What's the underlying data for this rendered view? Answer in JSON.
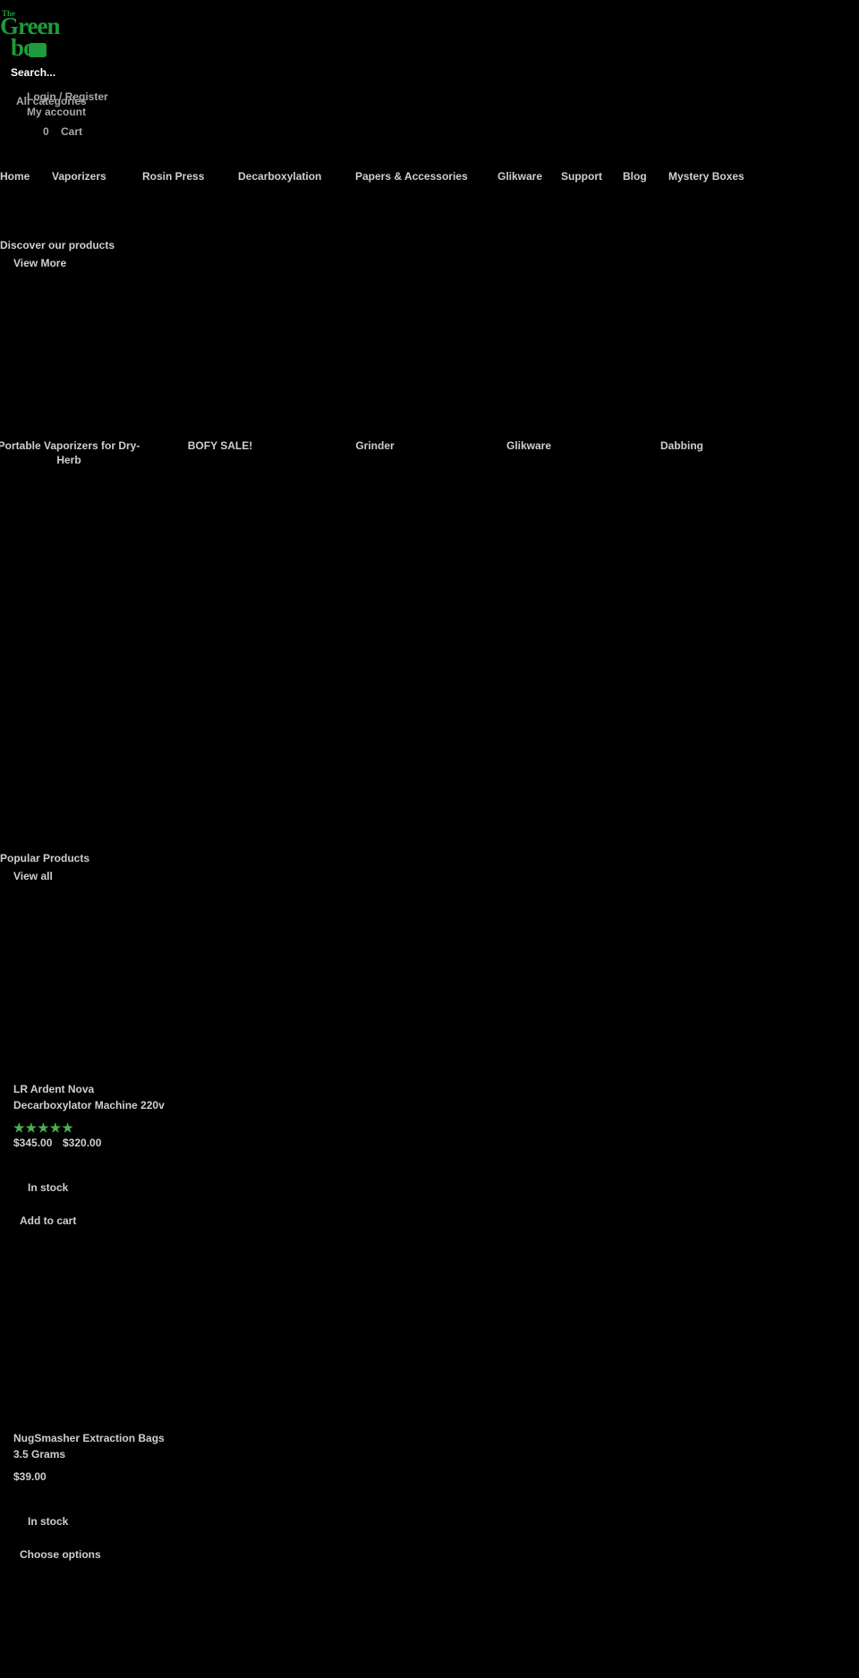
{
  "header": {
    "logo_text_1": "The",
    "logo_text_2": "Green",
    "logo_text_3": "box",
    "search_placeholder": "Search...",
    "categories_label": "All categories",
    "login_label": "Login / Register",
    "account_label": "My account",
    "cart_count": "0",
    "cart_label": "Cart"
  },
  "nav": {
    "items": [
      "Home",
      "Vaporizers",
      "Rosin Press",
      "Decarboxylation",
      "Papers & Accessories",
      "Glikware",
      "Support",
      "Blog",
      "Mystery Boxes"
    ]
  },
  "discover": {
    "title": "Discover our products",
    "view_more": "View More"
  },
  "categories": [
    {
      "label": "Portable Vaporizers for Dry-Herb"
    },
    {
      "label": "BOFY SALE!"
    },
    {
      "label": "Grinder"
    },
    {
      "label": "Glikware"
    },
    {
      "label": "Dabbing"
    }
  ],
  "popular": {
    "title": "Popular Products",
    "view_all": "View all"
  },
  "products": [
    {
      "title": "LR Ardent Nova Decarboxylator Machine 220v",
      "rating_stars": 5,
      "stars_text": "★★★★★",
      "price_old": "$345.00",
      "price_new": "$320.00",
      "stock": "In stock",
      "action": "Add to cart"
    },
    {
      "title": "NugSmasher Extraction Bags 3.5 Grams",
      "price": "$39.00",
      "stock": "In stock",
      "action": "Choose options"
    }
  ],
  "colors": {
    "background": "#000000",
    "text": "#cfcfcf",
    "brand_green": "#1e9b3a",
    "star_green": "#4caf50"
  }
}
